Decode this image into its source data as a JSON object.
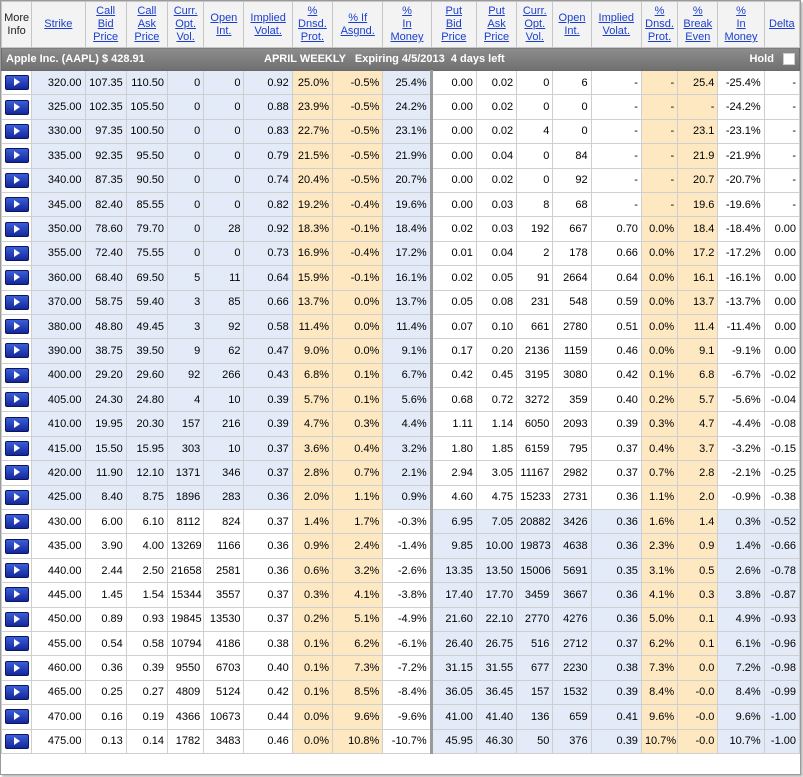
{
  "headers": {
    "more_info": [
      "More",
      "Info"
    ],
    "strike": "Strike",
    "call_bid": [
      "Call",
      "Bid",
      "Price"
    ],
    "call_ask": [
      "Call",
      "Ask",
      "Price"
    ],
    "call_curr": [
      "Curr.",
      "Opt.",
      "Vol."
    ],
    "call_open": [
      "Open",
      "Int."
    ],
    "call_iv": [
      "Implied",
      "Volat."
    ],
    "call_dnsd": [
      "%",
      "Dnsd.",
      "Prot."
    ],
    "call_assgnd": [
      "% If",
      "Asgnd."
    ],
    "call_in_money": [
      "%",
      "In",
      "Money"
    ],
    "put_bid": [
      "Put",
      "Bid",
      "Price"
    ],
    "put_ask": [
      "Put",
      "Ask",
      "Price"
    ],
    "put_curr": [
      "Curr.",
      "Opt.",
      "Vol."
    ],
    "put_open": [
      "Open",
      "Int."
    ],
    "put_iv": [
      "Implied",
      "Volat."
    ],
    "put_dnsd": [
      "%",
      "Dnsd.",
      "Prot."
    ],
    "break_even": [
      "%",
      "Break",
      "Even"
    ],
    "put_in_money": [
      "%",
      "In",
      "Money"
    ],
    "delta": "Delta"
  },
  "band": {
    "symbol": "Apple Inc. (AAPL) $ 428.91",
    "expiry": "APRIL WEEKLY   Expiring 4/5/2013  4 days left",
    "hold_label": "Hold"
  },
  "colors": {
    "orange_column": "#fde8c2",
    "in_the_money_blue": "#e4ebf8",
    "band_gray": "#7f7f7f",
    "header_link": "#1a3fd0",
    "button_blue": "#1f37b8"
  },
  "icons": {
    "row_button": "arrow-right-icon",
    "hold_checkbox": "checkbox-icon"
  },
  "rows": [
    {
      "strike": "320.00",
      "call_bid": "107.35",
      "call_ask": "110.50",
      "call_vol": "0",
      "call_oi": "0",
      "call_iv": "0.92",
      "call_dnsd": "25.0%",
      "call_assgnd": "-0.5%",
      "call_itm": "25.4%",
      "put_bid": "0.00",
      "put_ask": "0.02",
      "put_vol": "0",
      "put_oi": "6",
      "put_iv": "-",
      "put_dnsd": "-",
      "break_even": "25.4",
      "put_itm": "-25.4%",
      "delta": "-"
    },
    {
      "strike": "325.00",
      "call_bid": "102.35",
      "call_ask": "105.50",
      "call_vol": "0",
      "call_oi": "0",
      "call_iv": "0.88",
      "call_dnsd": "23.9%",
      "call_assgnd": "-0.5%",
      "call_itm": "24.2%",
      "put_bid": "0.00",
      "put_ask": "0.02",
      "put_vol": "0",
      "put_oi": "0",
      "put_iv": "-",
      "put_dnsd": "-",
      "break_even": "-",
      "put_itm": "-24.2%",
      "delta": "-"
    },
    {
      "strike": "330.00",
      "call_bid": "97.35",
      "call_ask": "100.50",
      "call_vol": "0",
      "call_oi": "0",
      "call_iv": "0.83",
      "call_dnsd": "22.7%",
      "call_assgnd": "-0.5%",
      "call_itm": "23.1%",
      "put_bid": "0.00",
      "put_ask": "0.02",
      "put_vol": "4",
      "put_oi": "0",
      "put_iv": "-",
      "put_dnsd": "-",
      "break_even": "23.1",
      "put_itm": "-23.1%",
      "delta": "-"
    },
    {
      "strike": "335.00",
      "call_bid": "92.35",
      "call_ask": "95.50",
      "call_vol": "0",
      "call_oi": "0",
      "call_iv": "0.79",
      "call_dnsd": "21.5%",
      "call_assgnd": "-0.5%",
      "call_itm": "21.9%",
      "put_bid": "0.00",
      "put_ask": "0.04",
      "put_vol": "0",
      "put_oi": "84",
      "put_iv": "-",
      "put_dnsd": "-",
      "break_even": "21.9",
      "put_itm": "-21.9%",
      "delta": "-"
    },
    {
      "strike": "340.00",
      "call_bid": "87.35",
      "call_ask": "90.50",
      "call_vol": "0",
      "call_oi": "0",
      "call_iv": "0.74",
      "call_dnsd": "20.4%",
      "call_assgnd": "-0.5%",
      "call_itm": "20.7%",
      "put_bid": "0.00",
      "put_ask": "0.02",
      "put_vol": "0",
      "put_oi": "92",
      "put_iv": "-",
      "put_dnsd": "-",
      "break_even": "20.7",
      "put_itm": "-20.7%",
      "delta": "-"
    },
    {
      "strike": "345.00",
      "call_bid": "82.40",
      "call_ask": "85.55",
      "call_vol": "0",
      "call_oi": "0",
      "call_iv": "0.82",
      "call_dnsd": "19.2%",
      "call_assgnd": "-0.4%",
      "call_itm": "19.6%",
      "put_bid": "0.00",
      "put_ask": "0.03",
      "put_vol": "8",
      "put_oi": "68",
      "put_iv": "-",
      "put_dnsd": "-",
      "break_even": "19.6",
      "put_itm": "-19.6%",
      "delta": "-"
    },
    {
      "strike": "350.00",
      "call_bid": "78.60",
      "call_ask": "79.70",
      "call_vol": "0",
      "call_oi": "28",
      "call_iv": "0.92",
      "call_dnsd": "18.3%",
      "call_assgnd": "-0.1%",
      "call_itm": "18.4%",
      "put_bid": "0.02",
      "put_ask": "0.03",
      "put_vol": "192",
      "put_oi": "667",
      "put_iv": "0.70",
      "put_dnsd": "0.0%",
      "break_even": "18.4",
      "put_itm": "-18.4%",
      "delta": "0.00"
    },
    {
      "strike": "355.00",
      "call_bid": "72.40",
      "call_ask": "75.55",
      "call_vol": "0",
      "call_oi": "0",
      "call_iv": "0.73",
      "call_dnsd": "16.9%",
      "call_assgnd": "-0.4%",
      "call_itm": "17.2%",
      "put_bid": "0.01",
      "put_ask": "0.04",
      "put_vol": "2",
      "put_oi": "178",
      "put_iv": "0.66",
      "put_dnsd": "0.0%",
      "break_even": "17.2",
      "put_itm": "-17.2%",
      "delta": "0.00"
    },
    {
      "strike": "360.00",
      "call_bid": "68.40",
      "call_ask": "69.50",
      "call_vol": "5",
      "call_oi": "11",
      "call_iv": "0.64",
      "call_dnsd": "15.9%",
      "call_assgnd": "-0.1%",
      "call_itm": "16.1%",
      "put_bid": "0.02",
      "put_ask": "0.05",
      "put_vol": "91",
      "put_oi": "2664",
      "put_iv": "0.64",
      "put_dnsd": "0.0%",
      "break_even": "16.1",
      "put_itm": "-16.1%",
      "delta": "0.00"
    },
    {
      "strike": "370.00",
      "call_bid": "58.75",
      "call_ask": "59.40",
      "call_vol": "3",
      "call_oi": "85",
      "call_iv": "0.66",
      "call_dnsd": "13.7%",
      "call_assgnd": "0.0%",
      "call_itm": "13.7%",
      "put_bid": "0.05",
      "put_ask": "0.08",
      "put_vol": "231",
      "put_oi": "548",
      "put_iv": "0.59",
      "put_dnsd": "0.0%",
      "break_even": "13.7",
      "put_itm": "-13.7%",
      "delta": "0.00"
    },
    {
      "strike": "380.00",
      "call_bid": "48.80",
      "call_ask": "49.45",
      "call_vol": "3",
      "call_oi": "92",
      "call_iv": "0.58",
      "call_dnsd": "11.4%",
      "call_assgnd": "0.0%",
      "call_itm": "11.4%",
      "put_bid": "0.07",
      "put_ask": "0.10",
      "put_vol": "661",
      "put_oi": "2780",
      "put_iv": "0.51",
      "put_dnsd": "0.0%",
      "break_even": "11.4",
      "put_itm": "-11.4%",
      "delta": "0.00"
    },
    {
      "strike": "390.00",
      "call_bid": "38.75",
      "call_ask": "39.50",
      "call_vol": "9",
      "call_oi": "62",
      "call_iv": "0.47",
      "call_dnsd": "9.0%",
      "call_assgnd": "0.0%",
      "call_itm": "9.1%",
      "put_bid": "0.17",
      "put_ask": "0.20",
      "put_vol": "2136",
      "put_oi": "1159",
      "put_iv": "0.46",
      "put_dnsd": "0.0%",
      "break_even": "9.1",
      "put_itm": "-9.1%",
      "delta": "0.00"
    },
    {
      "strike": "400.00",
      "call_bid": "29.20",
      "call_ask": "29.60",
      "call_vol": "92",
      "call_oi": "266",
      "call_iv": "0.43",
      "call_dnsd": "6.8%",
      "call_assgnd": "0.1%",
      "call_itm": "6.7%",
      "put_bid": "0.42",
      "put_ask": "0.45",
      "put_vol": "3195",
      "put_oi": "3080",
      "put_iv": "0.42",
      "put_dnsd": "0.1%",
      "break_even": "6.8",
      "put_itm": "-6.7%",
      "delta": "-0.02"
    },
    {
      "strike": "405.00",
      "call_bid": "24.30",
      "call_ask": "24.80",
      "call_vol": "4",
      "call_oi": "10",
      "call_iv": "0.39",
      "call_dnsd": "5.7%",
      "call_assgnd": "0.1%",
      "call_itm": "5.6%",
      "put_bid": "0.68",
      "put_ask": "0.72",
      "put_vol": "3272",
      "put_oi": "359",
      "put_iv": "0.40",
      "put_dnsd": "0.2%",
      "break_even": "5.7",
      "put_itm": "-5.6%",
      "delta": "-0.04"
    },
    {
      "strike": "410.00",
      "call_bid": "19.95",
      "call_ask": "20.30",
      "call_vol": "157",
      "call_oi": "216",
      "call_iv": "0.39",
      "call_dnsd": "4.7%",
      "call_assgnd": "0.3%",
      "call_itm": "4.4%",
      "put_bid": "1.11",
      "put_ask": "1.14",
      "put_vol": "6050",
      "put_oi": "2093",
      "put_iv": "0.39",
      "put_dnsd": "0.3%",
      "break_even": "4.7",
      "put_itm": "-4.4%",
      "delta": "-0.08"
    },
    {
      "strike": "415.00",
      "call_bid": "15.50",
      "call_ask": "15.95",
      "call_vol": "303",
      "call_oi": "10",
      "call_iv": "0.37",
      "call_dnsd": "3.6%",
      "call_assgnd": "0.4%",
      "call_itm": "3.2%",
      "put_bid": "1.80",
      "put_ask": "1.85",
      "put_vol": "6159",
      "put_oi": "795",
      "put_iv": "0.37",
      "put_dnsd": "0.4%",
      "break_even": "3.7",
      "put_itm": "-3.2%",
      "delta": "-0.15"
    },
    {
      "strike": "420.00",
      "call_bid": "11.90",
      "call_ask": "12.10",
      "call_vol": "1371",
      "call_oi": "346",
      "call_iv": "0.37",
      "call_dnsd": "2.8%",
      "call_assgnd": "0.7%",
      "call_itm": "2.1%",
      "put_bid": "2.94",
      "put_ask": "3.05",
      "put_vol": "11167",
      "put_oi": "2982",
      "put_iv": "0.37",
      "put_dnsd": "0.7%",
      "break_even": "2.8",
      "put_itm": "-2.1%",
      "delta": "-0.25"
    },
    {
      "strike": "425.00",
      "call_bid": "8.40",
      "call_ask": "8.75",
      "call_vol": "1896",
      "call_oi": "283",
      "call_iv": "0.36",
      "call_dnsd": "2.0%",
      "call_assgnd": "1.1%",
      "call_itm": "0.9%",
      "put_bid": "4.60",
      "put_ask": "4.75",
      "put_vol": "15233",
      "put_oi": "2731",
      "put_iv": "0.36",
      "put_dnsd": "1.1%",
      "break_even": "2.0",
      "put_itm": "-0.9%",
      "delta": "-0.38"
    },
    {
      "strike": "430.00",
      "call_bid": "6.00",
      "call_ask": "6.10",
      "call_vol": "8112",
      "call_oi": "824",
      "call_iv": "0.37",
      "call_dnsd": "1.4%",
      "call_assgnd": "1.7%",
      "call_itm": "-0.3%",
      "put_bid": "6.95",
      "put_ask": "7.05",
      "put_vol": "20882",
      "put_oi": "3426",
      "put_iv": "0.36",
      "put_dnsd": "1.6%",
      "break_even": "1.4",
      "put_itm": "0.3%",
      "delta": "-0.52"
    },
    {
      "strike": "435.00",
      "call_bid": "3.90",
      "call_ask": "4.00",
      "call_vol": "13269",
      "call_oi": "1166",
      "call_iv": "0.36",
      "call_dnsd": "0.9%",
      "call_assgnd": "2.4%",
      "call_itm": "-1.4%",
      "put_bid": "9.85",
      "put_ask": "10.00",
      "put_vol": "19873",
      "put_oi": "4638",
      "put_iv": "0.36",
      "put_dnsd": "2.3%",
      "break_even": "0.9",
      "put_itm": "1.4%",
      "delta": "-0.66"
    },
    {
      "strike": "440.00",
      "call_bid": "2.44",
      "call_ask": "2.50",
      "call_vol": "21658",
      "call_oi": "2581",
      "call_iv": "0.36",
      "call_dnsd": "0.6%",
      "call_assgnd": "3.2%",
      "call_itm": "-2.6%",
      "put_bid": "13.35",
      "put_ask": "13.50",
      "put_vol": "15006",
      "put_oi": "5691",
      "put_iv": "0.35",
      "put_dnsd": "3.1%",
      "break_even": "0.5",
      "put_itm": "2.6%",
      "delta": "-0.78"
    },
    {
      "strike": "445.00",
      "call_bid": "1.45",
      "call_ask": "1.54",
      "call_vol": "15344",
      "call_oi": "3557",
      "call_iv": "0.37",
      "call_dnsd": "0.3%",
      "call_assgnd": "4.1%",
      "call_itm": "-3.8%",
      "put_bid": "17.40",
      "put_ask": "17.70",
      "put_vol": "3459",
      "put_oi": "3667",
      "put_iv": "0.36",
      "put_dnsd": "4.1%",
      "break_even": "0.3",
      "put_itm": "3.8%",
      "delta": "-0.87"
    },
    {
      "strike": "450.00",
      "call_bid": "0.89",
      "call_ask": "0.93",
      "call_vol": "19845",
      "call_oi": "13530",
      "call_iv": "0.37",
      "call_dnsd": "0.2%",
      "call_assgnd": "5.1%",
      "call_itm": "-4.9%",
      "put_bid": "21.60",
      "put_ask": "22.10",
      "put_vol": "2770",
      "put_oi": "4276",
      "put_iv": "0.36",
      "put_dnsd": "5.0%",
      "break_even": "0.1",
      "put_itm": "4.9%",
      "delta": "-0.93"
    },
    {
      "strike": "455.00",
      "call_bid": "0.54",
      "call_ask": "0.58",
      "call_vol": "10794",
      "call_oi": "4186",
      "call_iv": "0.38",
      "call_dnsd": "0.1%",
      "call_assgnd": "6.2%",
      "call_itm": "-6.1%",
      "put_bid": "26.40",
      "put_ask": "26.75",
      "put_vol": "516",
      "put_oi": "2712",
      "put_iv": "0.37",
      "put_dnsd": "6.2%",
      "break_even": "0.1",
      "put_itm": "6.1%",
      "delta": "-0.96"
    },
    {
      "strike": "460.00",
      "call_bid": "0.36",
      "call_ask": "0.39",
      "call_vol": "9550",
      "call_oi": "6703",
      "call_iv": "0.40",
      "call_dnsd": "0.1%",
      "call_assgnd": "7.3%",
      "call_itm": "-7.2%",
      "put_bid": "31.15",
      "put_ask": "31.55",
      "put_vol": "677",
      "put_oi": "2230",
      "put_iv": "0.38",
      "put_dnsd": "7.3%",
      "break_even": "0.0",
      "put_itm": "7.2%",
      "delta": "-0.98"
    },
    {
      "strike": "465.00",
      "call_bid": "0.25",
      "call_ask": "0.27",
      "call_vol": "4809",
      "call_oi": "5124",
      "call_iv": "0.42",
      "call_dnsd": "0.1%",
      "call_assgnd": "8.5%",
      "call_itm": "-8.4%",
      "put_bid": "36.05",
      "put_ask": "36.45",
      "put_vol": "157",
      "put_oi": "1532",
      "put_iv": "0.39",
      "put_dnsd": "8.4%",
      "break_even": "-0.0",
      "put_itm": "8.4%",
      "delta": "-0.99"
    },
    {
      "strike": "470.00",
      "call_bid": "0.16",
      "call_ask": "0.19",
      "call_vol": "4366",
      "call_oi": "10673",
      "call_iv": "0.44",
      "call_dnsd": "0.0%",
      "call_assgnd": "9.6%",
      "call_itm": "-9.6%",
      "put_bid": "41.00",
      "put_ask": "41.40",
      "put_vol": "136",
      "put_oi": "659",
      "put_iv": "0.41",
      "put_dnsd": "9.6%",
      "break_even": "-0.0",
      "put_itm": "9.6%",
      "delta": "-1.00"
    },
    {
      "strike": "475.00",
      "call_bid": "0.13",
      "call_ask": "0.14",
      "call_vol": "1782",
      "call_oi": "3483",
      "call_iv": "0.46",
      "call_dnsd": "0.0%",
      "call_assgnd": "10.8%",
      "call_itm": "-10.7%",
      "put_bid": "45.95",
      "put_ask": "46.30",
      "put_vol": "50",
      "put_oi": "376",
      "put_iv": "0.39",
      "put_dnsd": "10.7%",
      "break_even": "-0.0",
      "put_itm": "10.7%",
      "delta": "-1.00"
    }
  ]
}
